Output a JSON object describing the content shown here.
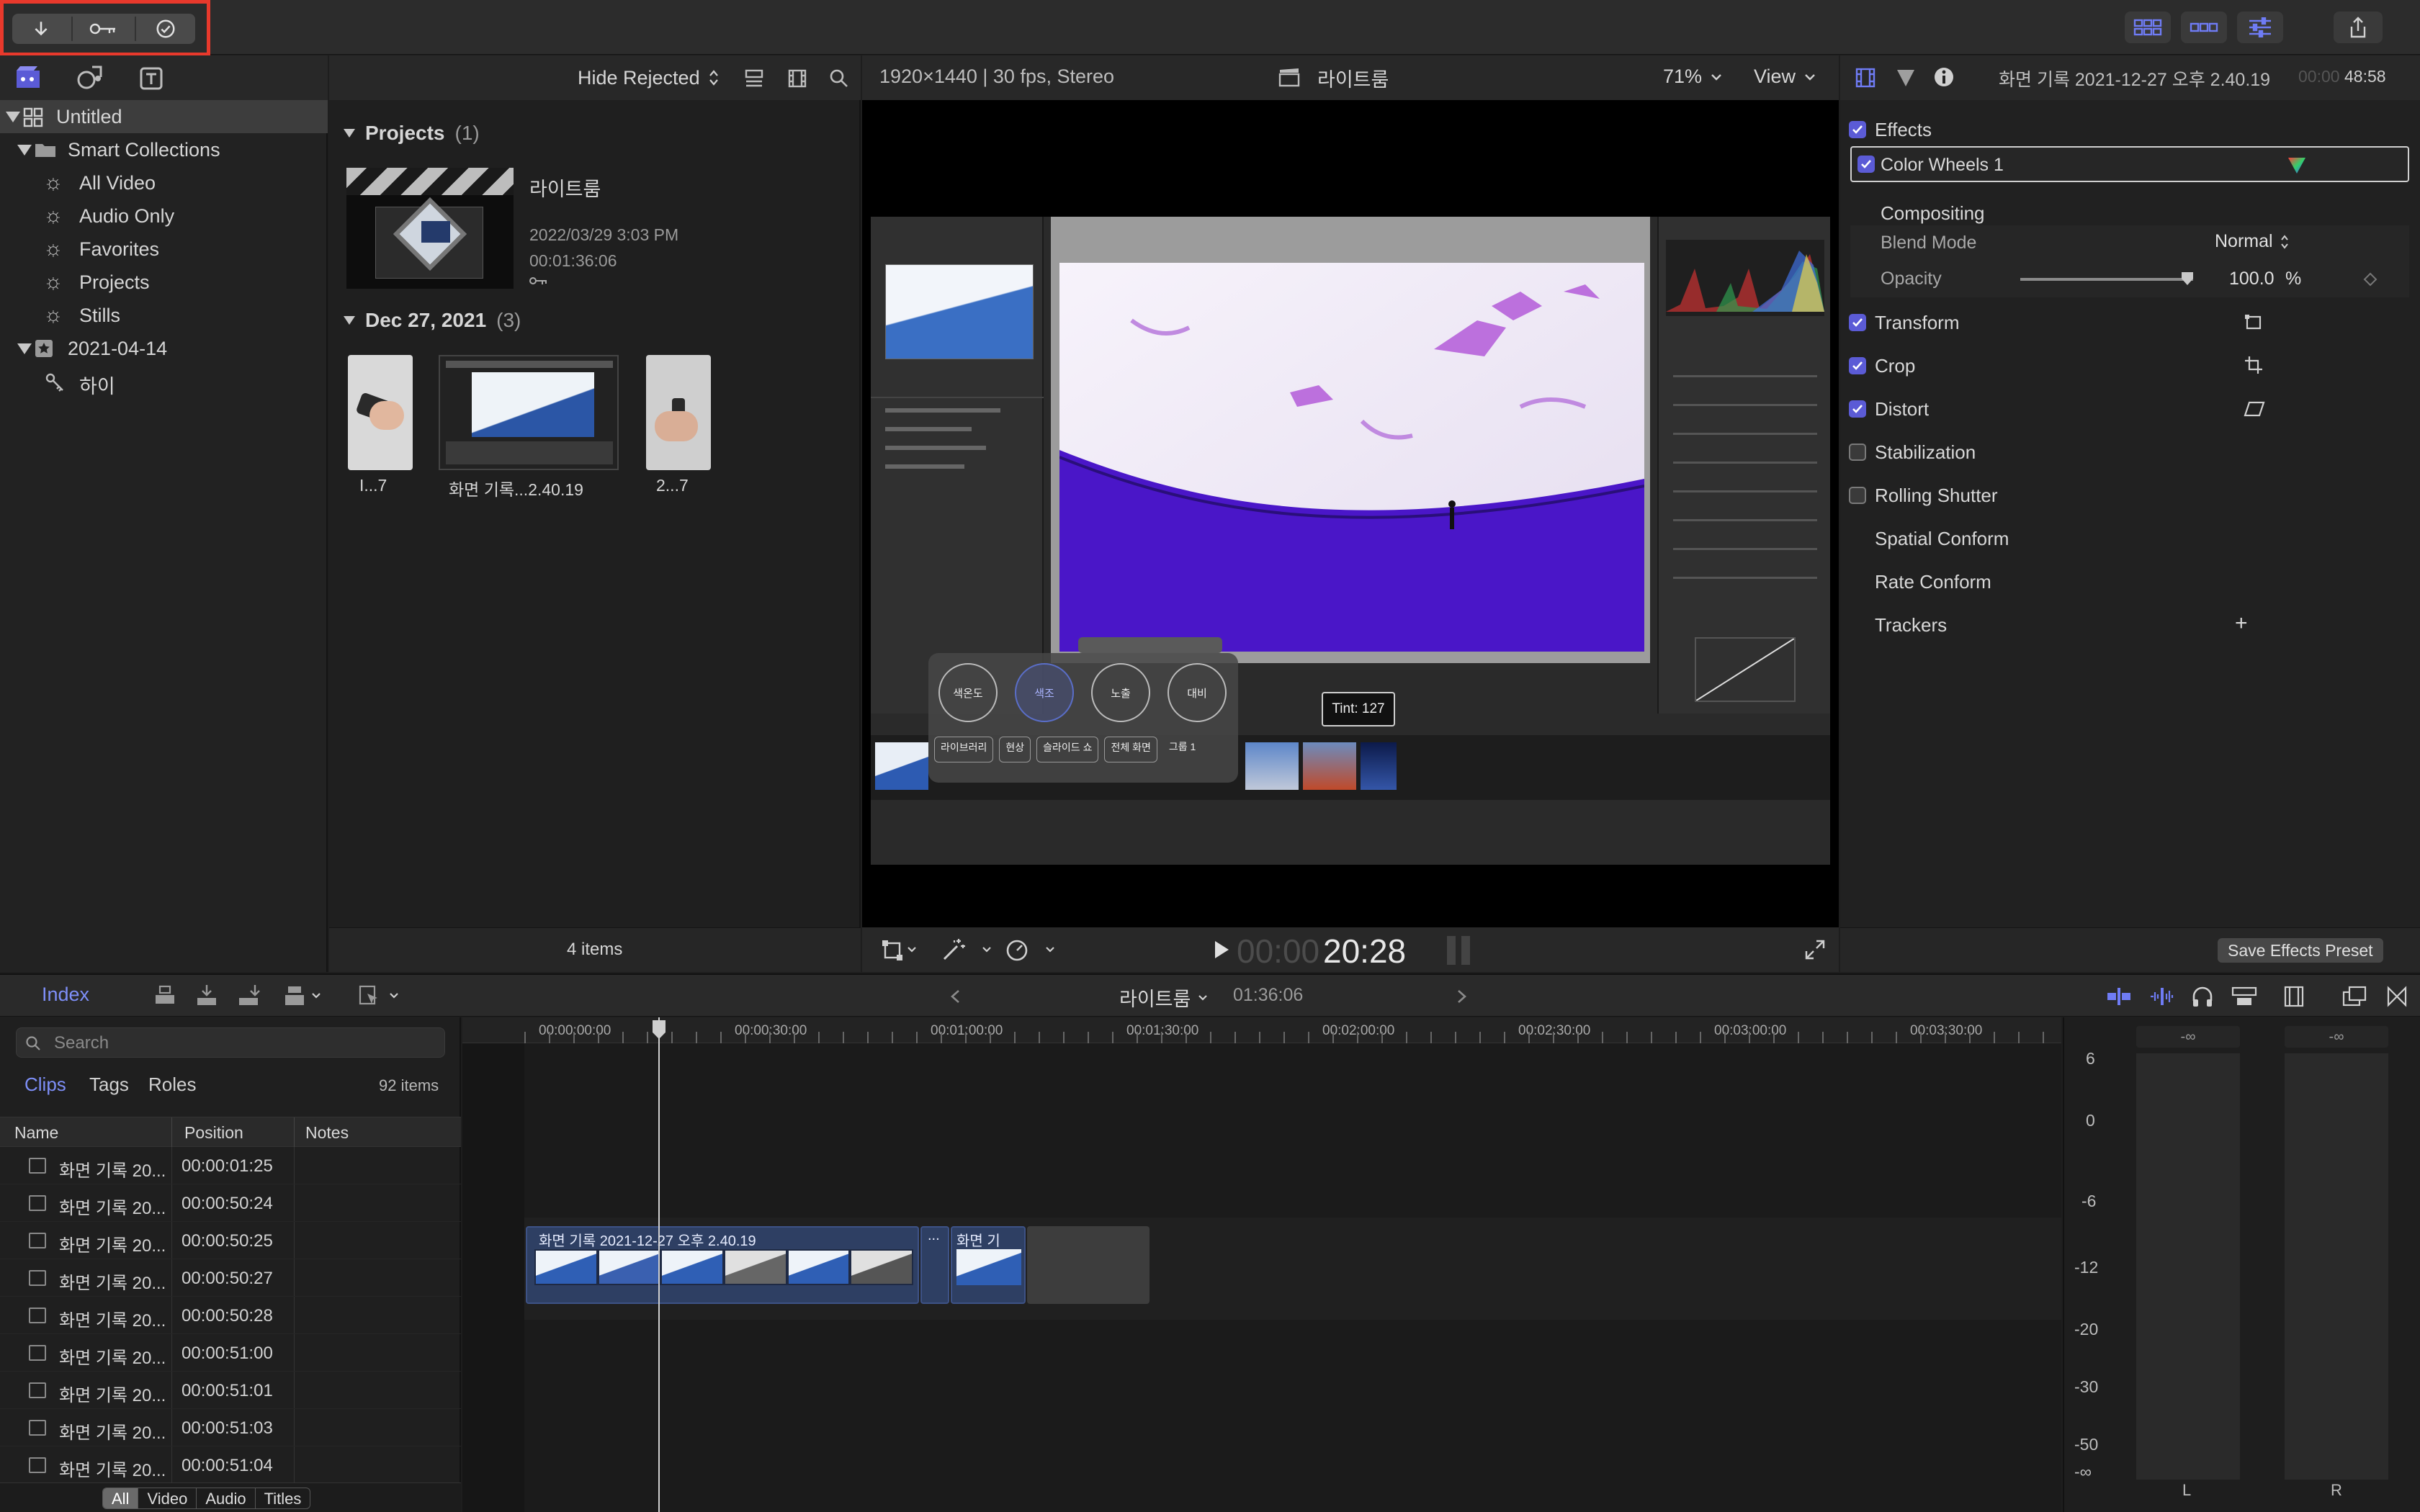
{
  "toolbar": {
    "import_icon": "download-arrow-icon",
    "keyword_icon": "key-icon",
    "analyze_icon": "checkmark-circle-icon"
  },
  "browser": {
    "filter": "Hide Rejected",
    "library": "Untitled",
    "sidebar": [
      {
        "label": "Smart Collections",
        "kind": "folder"
      },
      {
        "label": "All Video",
        "kind": "smart"
      },
      {
        "label": "Audio Only",
        "kind": "smart"
      },
      {
        "label": "Favorites",
        "kind": "smart"
      },
      {
        "label": "Projects",
        "kind": "smart"
      },
      {
        "label": "Stills",
        "kind": "smart"
      },
      {
        "label": "2021-04-14",
        "kind": "event"
      },
      {
        "label": "하이",
        "kind": "keyword"
      }
    ],
    "projects_header": "Projects",
    "projects_count": "(1)",
    "project": {
      "name": "라이트룸",
      "date": "2022/03/29 3:03 PM",
      "duration": "00:01:36:06"
    },
    "event_header": "Dec 27, 2021",
    "event_count": "(3)",
    "clips": [
      {
        "label": "I...7"
      },
      {
        "label": "화면 기록...2.40.19"
      },
      {
        "label": "2...7"
      }
    ],
    "items_count": "4 items"
  },
  "viewer": {
    "format": "1920×1440 | 30 fps, Stereo",
    "title": "라이트룸",
    "zoom": "71%",
    "view": "View",
    "tooltip": "Tint: 127",
    "timecode_dim": "00:00",
    "timecode": "20:28",
    "overlay_buttons": [
      "색온도",
      "색조",
      "노출",
      "대비"
    ],
    "overlay_tabs": [
      "라이브러리",
      "현상",
      "슬라이드 쇼",
      "전체 화면",
      "그룹 1"
    ]
  },
  "inspector": {
    "clip_name": "화면 기록 2021-12-27 오후 2.40.19",
    "duration_dim": "00:00",
    "duration": "48:58",
    "effects": "Effects",
    "color_wheels": "Color Wheels 1",
    "compositing": "Compositing",
    "blend_mode_label": "Blend Mode",
    "blend_mode_value": "Normal",
    "opacity_label": "Opacity",
    "opacity_value": "100.0",
    "opacity_unit": "%",
    "opacity_level": 1.0,
    "sections": [
      {
        "label": "Transform",
        "checked": true
      },
      {
        "label": "Crop",
        "checked": true
      },
      {
        "label": "Distort",
        "checked": true
      },
      {
        "label": "Stabilization",
        "checked": false
      },
      {
        "label": "Rolling Shutter",
        "checked": false
      },
      {
        "label": "Spatial Conform",
        "checked": null
      },
      {
        "label": "Rate Conform",
        "checked": null
      },
      {
        "label": "Trackers",
        "checked": null
      }
    ],
    "trackers_add": "+",
    "save_preset": "Save Effects Preset"
  },
  "timeline": {
    "index_tab": "Index",
    "project_name": "라이트룸",
    "project_duration": "01:36:06",
    "search_placeholder": "Search",
    "index_tabs": [
      "Clips",
      "Tags",
      "Roles"
    ],
    "items_count": "92 items",
    "columns": [
      "Name",
      "Position",
      "Notes"
    ],
    "rows": [
      {
        "name": "화면 기록 20...",
        "position": "00:00:01:25"
      },
      {
        "name": "화면 기록 20...",
        "position": "00:00:50:24"
      },
      {
        "name": "화면 기록 20...",
        "position": "00:00:50:25"
      },
      {
        "name": "화면 기록 20...",
        "position": "00:00:50:27"
      },
      {
        "name": "화면 기록 20...",
        "position": "00:00:50:28"
      },
      {
        "name": "화면 기록 20...",
        "position": "00:00:51:00"
      },
      {
        "name": "화면 기록 20...",
        "position": "00:00:51:01"
      },
      {
        "name": "화면 기록 20...",
        "position": "00:00:51:03"
      },
      {
        "name": "화면 기록 20...",
        "position": "00:00:51:04"
      }
    ],
    "filter_tabs": [
      "All",
      "Video",
      "Audio",
      "Titles"
    ],
    "ruler": [
      "00:00:00:00",
      "00:00:30:00",
      "00:01:00:00",
      "00:01:30:00",
      "00:02:00:00",
      "00:02:30:00",
      "00:03:00:00",
      "00:03:30:00"
    ],
    "clip1": "화면 기록 2021-12-27 오후 2.40.19",
    "clip2_dots": "...",
    "clip3": "화면 기록...",
    "meters": {
      "scale": [
        "6",
        "0",
        "-6",
        "-12",
        "-20",
        "-30",
        "-50",
        "-∞"
      ],
      "left_peak": "-∞",
      "right_peak": "-∞",
      "left": "L",
      "right": "R"
    }
  },
  "colors": {
    "accent": "#5b5bd6",
    "highlight_red": "#e8392c",
    "clip_blue": "#2e3f63",
    "link_blue": "#5e8cf0"
  }
}
